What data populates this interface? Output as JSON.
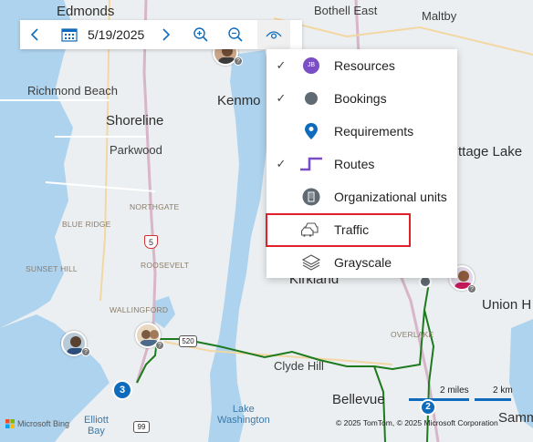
{
  "toolbar": {
    "date": "5/19/2025",
    "icons": [
      "chevron-left-icon",
      "calendar-icon",
      "chevron-right-icon",
      "zoom-in-icon",
      "zoom-out-icon",
      "eye-icon"
    ]
  },
  "menu": {
    "items": [
      {
        "label": "Resources",
        "checked": true,
        "icon": "resources-jb-icon",
        "icon_text": "JB"
      },
      {
        "label": "Bookings",
        "checked": true,
        "icon": "booking-circle-icon"
      },
      {
        "label": "Requirements",
        "checked": false,
        "icon": "pin-icon"
      },
      {
        "label": "Routes",
        "checked": true,
        "icon": "route-icon"
      },
      {
        "label": "Organizational units",
        "checked": false,
        "icon": "building-icon"
      },
      {
        "label": "Traffic",
        "checked": false,
        "icon": "traffic-icon"
      },
      {
        "label": "Grayscale",
        "checked": false,
        "icon": "layers-icon"
      }
    ],
    "check_glyph": "✓"
  },
  "map": {
    "labels": {
      "edmonds": "Edmonds",
      "bothell_east": "Bothell East",
      "maltby": "Maltby",
      "richmond_beach": "Richmond Beach",
      "kenmore": "Kenmo",
      "shoreline": "Shoreline",
      "parkwood": "Parkwood",
      "cottage_lake": "ttage Lake",
      "northgate": "NORTHGATE",
      "blue_ridge": "BLUE RIDGE",
      "roosevelt": "ROOSEVELT",
      "sunset_hill": "SUNSET HILL",
      "kirkland": "Kirkland",
      "union_hill": "Union H",
      "wallingford": "WALLINGFORD",
      "overlake": "OVERLAKE",
      "clyde_hill": "Clyde Hill",
      "bellevue": "Bellevue",
      "lake_washington": "Lake\nWashington",
      "elliott_bay": "Elliott\nBay",
      "samm": "Samm"
    },
    "shields": {
      "i5": "5",
      "sr520": "520",
      "sr99": "99"
    },
    "cluster_counts": {
      "a": "3",
      "b": "2"
    },
    "scale_miles": "2 miles",
    "scale_km": "2 km",
    "copyright": "© 2025 TomTom, © 2025 Microsoft Corporation",
    "brand": "Microsoft Bing",
    "badge": "?"
  },
  "colors": {
    "accent": "#0f6cbd",
    "route": "#1e7a1e",
    "highlight": "#e0202a",
    "resource_purple": "#7a4ec4",
    "booking_gray": "#5f6a72",
    "water": "#aed3ee"
  }
}
